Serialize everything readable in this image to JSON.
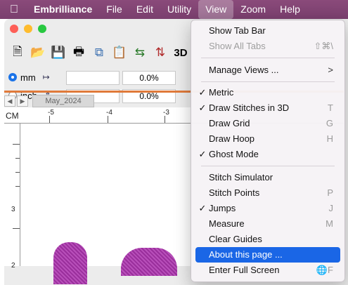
{
  "menubar": {
    "app_name": "Embrilliance",
    "items": [
      "File",
      "Edit",
      "Utility",
      "View",
      "Zoom",
      "Help"
    ]
  },
  "units": {
    "mm_label": "mm",
    "inch_label": "inch",
    "field1_value": "",
    "field1_pct": "0.0%",
    "field2_value": "",
    "field2_pct": "0.0%"
  },
  "toolbar": {
    "view3d_label": "3D"
  },
  "tab": {
    "name": "May_2024"
  },
  "ruler": {
    "unit": "CM",
    "h_labels": [
      "-5",
      "-4",
      "-3"
    ],
    "v_labels": [
      "3",
      "2"
    ]
  },
  "view_menu": {
    "show_tab_bar": "Show Tab Bar",
    "show_all_tabs": "Show All Tabs",
    "show_all_tabs_sc": "⇧⌘\\",
    "manage_views": "Manage Views ...",
    "manage_views_arrow": ">",
    "metric": "Metric",
    "draw_stitches_3d": "Draw Stitches in 3D",
    "draw_stitches_3d_sc": "T",
    "draw_grid": "Draw Grid",
    "draw_grid_sc": "G",
    "draw_hoop": "Draw Hoop",
    "draw_hoop_sc": "H",
    "ghost_mode": "Ghost Mode",
    "stitch_simulator": "Stitch Simulator",
    "stitch_points": "Stitch Points",
    "stitch_points_sc": "P",
    "jumps": "Jumps",
    "jumps_sc": "J",
    "measure": "Measure",
    "measure_sc": "M",
    "clear_guides": "Clear Guides",
    "about_page": "About this page ...",
    "enter_full_screen": "Enter Full Screen",
    "enter_full_screen_sc": "🌐F",
    "checkmark": "✓"
  }
}
